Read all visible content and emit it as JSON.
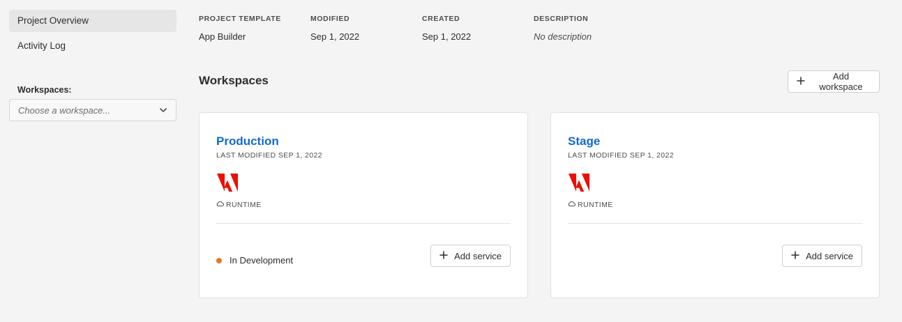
{
  "sidebar": {
    "items": [
      {
        "label": "Project Overview",
        "active": true
      },
      {
        "label": "Activity Log",
        "active": false
      }
    ],
    "workspaces_label": "Workspaces:",
    "workspace_select": {
      "placeholder": "Choose a workspace..."
    }
  },
  "project": {
    "template_header": "PROJECT TEMPLATE",
    "template_value": "App Builder",
    "modified_header": "MODIFIED",
    "modified_value": "Sep 1, 2022",
    "created_header": "CREATED",
    "created_value": "Sep 1, 2022",
    "description_header": "DESCRIPTION",
    "description_value": "No description"
  },
  "workspaces": {
    "title": "Workspaces",
    "add_button_label": "Add workspace",
    "cards": [
      {
        "name": "Production",
        "last_modified": "LAST MODIFIED SEP 1, 2022",
        "service_icon": "adobe-logo-icon",
        "runtime_label": "RUNTIME",
        "status": "In Development",
        "status_color": "#e07b24",
        "add_service_label": "Add service"
      },
      {
        "name": "Stage",
        "last_modified": "LAST MODIFIED SEP 1, 2022",
        "service_icon": "adobe-logo-icon",
        "runtime_label": "RUNTIME",
        "add_service_label": "Add service"
      }
    ]
  },
  "colors": {
    "link": "#1269cf",
    "adobe_red": "#eb1000",
    "status_orange": "#e07b24"
  }
}
